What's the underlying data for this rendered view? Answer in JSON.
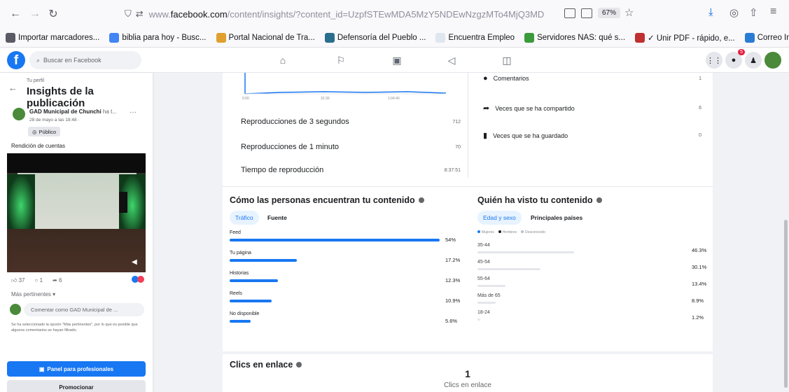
{
  "browser": {
    "url_prefix": "www.",
    "url_domain": "facebook.com",
    "url_rest": "/content/insights/?content_id=UzpfSTEwMDA5MzY5NDEwNzgzMTo4MjQ3MD",
    "zoom": "67%"
  },
  "bookmarks": [
    {
      "label": "Importar marcadores...",
      "color": "#5b5b66"
    },
    {
      "label": "biblia para hoy - Busc...",
      "color": "#4285f4"
    },
    {
      "label": "Portal Nacional de Tra...",
      "color": "#e0a030"
    },
    {
      "label": "Defensoría del Pueblo ...",
      "color": "#2a6e8e"
    },
    {
      "label": "Encuentra Empleo",
      "color": "#dfe6ee"
    },
    {
      "label": "Servidores NAS: qué s...",
      "color": "#3b9a3b"
    },
    {
      "label": "✓ Unir PDF - rápido, e...",
      "color": "#c03030"
    },
    {
      "label": "Correo Institucional M...",
      "color": "#2a7bd4"
    }
  ],
  "facebook": {
    "search_placeholder": "Buscar en Facebook",
    "notification_badge": "5"
  },
  "left": {
    "breadcrumb": "Tu perfil",
    "title": "Insights de la publicación",
    "page_name": "GAD Municipal de Chunchi",
    "page_suffix": "ha t...",
    "date": "28 de mayo a las 18:48 ·",
    "privacy": "Público",
    "post_text": "Rendición de cuentas",
    "likes": "37",
    "comments": "1",
    "shares": "6",
    "sort_label": "Más pertinentes",
    "comment_placeholder": "Comentar como GAD Municipal de ...",
    "note": "Se ha seleccionado la opción \"Más pertinentes\", por lo que es posible que algunos comentarios se hayan filtrado.",
    "pro_button": "Panel para profesionales",
    "promote_button": "Promocionar"
  },
  "chart_axis": [
    "0:00",
    "32:30",
    "1:04:40"
  ],
  "video_stats": [
    {
      "label": "Reproducciones de 3 segundos",
      "value": "712"
    },
    {
      "label": "Reproducciones de 1 minuto",
      "value": "70"
    },
    {
      "label": "Tiempo de reproducción",
      "value": "8:37:51"
    }
  ],
  "interactions": [
    {
      "label": "Comentarios",
      "value": "1"
    },
    {
      "label": "Veces que se ha compartido",
      "value": "6"
    },
    {
      "label": "Veces que se ha guardado",
      "value": "0"
    }
  ],
  "discovery": {
    "title": "Cómo las personas encuentran tu contenido",
    "tab_active": "Tráfico",
    "tab_other": "Fuente",
    "rows": [
      {
        "label": "Feed",
        "pct": "54%",
        "fraction": 1.0
      },
      {
        "label": "Tu página",
        "pct": "17.2%",
        "fraction": 0.32
      },
      {
        "label": "Historias",
        "pct": "12.3%",
        "fraction": 0.23
      },
      {
        "label": "Reels",
        "pct": "10.9%",
        "fraction": 0.2
      },
      {
        "label": "No disponible",
        "pct": "5.6%",
        "fraction": 0.1
      }
    ]
  },
  "audience": {
    "title": "Quién ha visto tu contenido",
    "tab_active": "Edad y sexo",
    "tab_other": "Principales países",
    "legend": [
      "Mujeres",
      "Hombres",
      "Desconocido"
    ],
    "legend_colors": [
      "#1877f2",
      "#1c1e21",
      "#bcc0c4"
    ],
    "rows": [
      {
        "label": "35-44",
        "pct": "46.3%",
        "fraction": 1.0
      },
      {
        "label": "45-54",
        "pct": "30.1%",
        "fraction": 0.65
      },
      {
        "label": "55-64",
        "pct": "13.4%",
        "fraction": 0.29
      },
      {
        "label": "Más de 65",
        "pct": "8.9%",
        "fraction": 0.19
      },
      {
        "label": "18-24",
        "pct": "1.2%",
        "fraction": 0.03
      }
    ]
  },
  "link_clicks": {
    "title": "Clics en enlace",
    "value": "1",
    "caption": "Clics en enlace"
  }
}
